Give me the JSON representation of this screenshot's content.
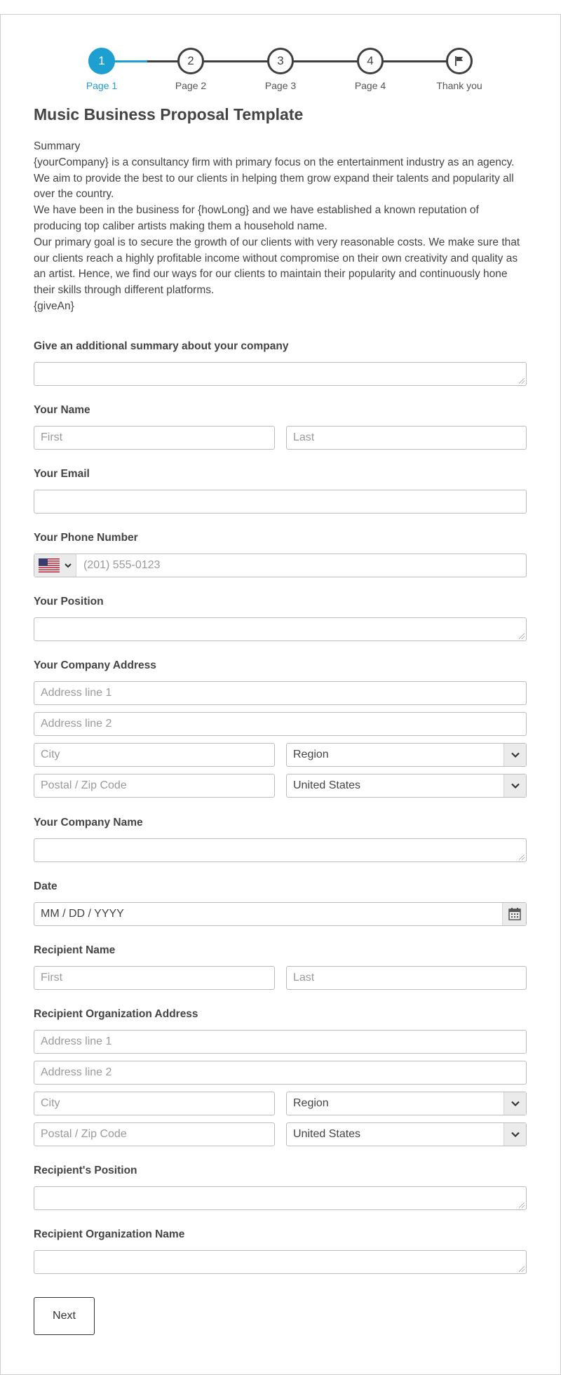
{
  "steps": [
    {
      "number": "1",
      "label": "Page 1"
    },
    {
      "number": "2",
      "label": "Page 2"
    },
    {
      "number": "3",
      "label": "Page 3"
    },
    {
      "number": "4",
      "label": "Page 4"
    },
    {
      "number": "",
      "label": "Thank you"
    }
  ],
  "title": "Music Business Proposal Template",
  "summary": {
    "heading": "Summary",
    "p1": "{yourCompany} is a consultancy firm with primary focus on the entertainment industry as an agency. We aim to provide the best to our clients in helping them grow expand their talents and popularity all over the country.",
    "p2": "We have been in the business for {howLong} and we have established a known reputation of producing top caliber artists making them a household name.",
    "p3": "Our primary goal is to secure the growth of our clients with very reasonable costs. We make sure that our clients reach a highly profitable income without compromise on their own creativity and quality as an artist. Hence, we find our ways for our clients to maintain their popularity and continuously hone their skills through different platforms.",
    "p4": "{giveAn}"
  },
  "fields": {
    "additional_summary": "Give an additional summary about your company",
    "your_name": "Your Name",
    "your_email": "Your Email",
    "your_phone": "Your Phone Number",
    "your_position": "Your Position",
    "company_address": "Your Company Address",
    "company_name": "Your Company Name",
    "date": "Date",
    "recipient_name": "Recipient Name",
    "recipient_address": "Recipient Organization Address",
    "recipient_position": "Recipient's Position",
    "recipient_org_name": "Recipient Organization Name"
  },
  "placeholders": {
    "first": "First",
    "last": "Last",
    "phone": "(201) 555-0123",
    "address1": "Address line 1",
    "address2": "Address line 2",
    "city": "City",
    "postal": "Postal / Zip Code",
    "date": "MM / DD / YYYY"
  },
  "selects": {
    "region": "Region",
    "country": "United States"
  },
  "buttons": {
    "next": "Next"
  },
  "colors": {
    "accent": "#1e9fd1",
    "step_line": "#3f3f3f",
    "border": "#bdbdbd"
  },
  "icons": {
    "flag": "us-flag-icon",
    "chevron": "chevron-down-icon",
    "calendar": "calendar-icon",
    "finish": "flag-icon"
  }
}
